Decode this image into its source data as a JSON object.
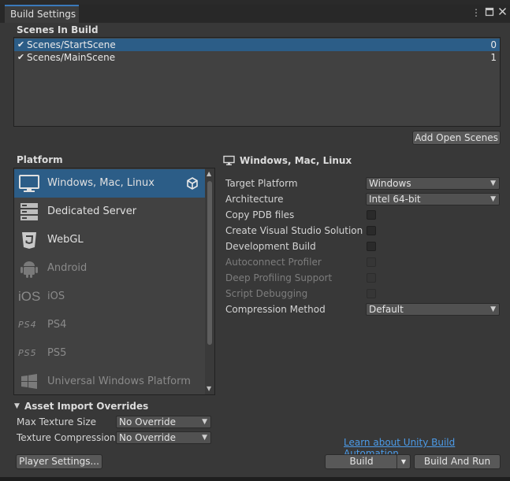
{
  "window": {
    "tab_title": "Build Settings",
    "menu_icon": "kebab-menu-icon",
    "maximize_icon": "maximize-icon",
    "close_icon": "close-icon"
  },
  "scenes": {
    "header": "Scenes In Build",
    "items": [
      {
        "name": "Scenes/StartScene",
        "index": "0",
        "checked": true,
        "selected": true
      },
      {
        "name": "Scenes/MainScene",
        "index": "1",
        "checked": true,
        "selected": false
      }
    ],
    "add_open_scenes_label": "Add Open Scenes"
  },
  "platform": {
    "header": "Platform",
    "items": [
      {
        "label": "Windows, Mac, Linux",
        "icon": "monitor-icon",
        "selected": true,
        "enabled": true
      },
      {
        "label": "Dedicated Server",
        "icon": "server-icon",
        "selected": false,
        "enabled": true
      },
      {
        "label": "WebGL",
        "icon": "html5-icon",
        "selected": false,
        "enabled": true
      },
      {
        "label": "Android",
        "icon": "android-icon",
        "selected": false,
        "enabled": false
      },
      {
        "label": "iOS",
        "icon": "ios-icon",
        "icon_text": "iOS",
        "selected": false,
        "enabled": false
      },
      {
        "label": "PS4",
        "icon": "ps4-icon",
        "icon_text": "PS4",
        "selected": false,
        "enabled": false
      },
      {
        "label": "PS5",
        "icon": "ps5-icon",
        "icon_text": "PS5",
        "selected": false,
        "enabled": false
      },
      {
        "label": "Universal Windows Platform",
        "icon": "windows-logo-icon",
        "selected": false,
        "enabled": false
      }
    ],
    "active_badge_icon": "unity-logo-icon"
  },
  "settings": {
    "title": "Windows, Mac, Linux",
    "title_icon": "monitor-icon",
    "target_platform": {
      "label": "Target Platform",
      "value": "Windows"
    },
    "architecture": {
      "label": "Architecture",
      "value": "Intel 64-bit"
    },
    "copy_pdb": {
      "label": "Copy PDB files",
      "checked": false
    },
    "create_vs": {
      "label": "Create Visual Studio Solution",
      "checked": false
    },
    "dev_build": {
      "label": "Development Build",
      "checked": false
    },
    "autoconnect": {
      "label": "Autoconnect Profiler",
      "checked": false,
      "enabled": false
    },
    "deep_profiling": {
      "label": "Deep Profiling Support",
      "checked": false,
      "enabled": false
    },
    "script_debugging": {
      "label": "Script Debugging",
      "checked": false,
      "enabled": false
    },
    "compression": {
      "label": "Compression Method",
      "value": "Default"
    }
  },
  "asset_import": {
    "header": "Asset Import Overrides",
    "max_texture_size": {
      "label": "Max Texture Size",
      "value": "No Override"
    },
    "texture_compression": {
      "label": "Texture Compression",
      "value": "No Override"
    }
  },
  "footer": {
    "learn_link": "Learn about Unity Build Automation",
    "player_settings_label": "Player Settings...",
    "build_label": "Build",
    "build_and_run_label": "Build And Run"
  },
  "colors": {
    "accent": "#2c5d87",
    "link": "#4c9be8",
    "tab_accent": "#3a79bb"
  }
}
